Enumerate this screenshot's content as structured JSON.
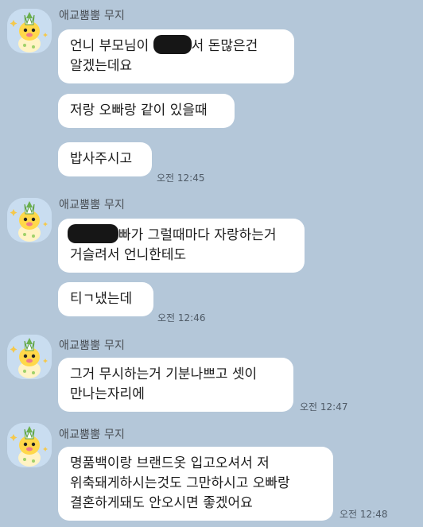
{
  "sender_name": "애교뿜뿜 무지",
  "messages": [
    {
      "line1_pre": "언니 부모님이 ",
      "line1_post": "서 돈많은건",
      "line2": "알겠는데요"
    },
    {
      "text": "저랑 오빠랑 같이 있을때"
    },
    {
      "text": "밥사주시고",
      "time": "오전 12:45"
    },
    {
      "line1_post": "빠가 그럴때마다 자랑하는거",
      "line2": "거슬려서 언니한테도"
    },
    {
      "text": "티ㄱ냈는데",
      "time": "오전 12:46"
    },
    {
      "line1": "그거 무시하는거 기분나쁘고 셋이",
      "line2": "만나는자리에",
      "time": "오전 12:47"
    },
    {
      "line1": "명품백이랑 브랜드옷 입고오셔서 저",
      "line2": "위축돼게하시는것도 그만하시고 오빠랑",
      "line3": "결혼하게돼도 안오시면 좋겠어요",
      "time": "오전 12:48"
    }
  ]
}
